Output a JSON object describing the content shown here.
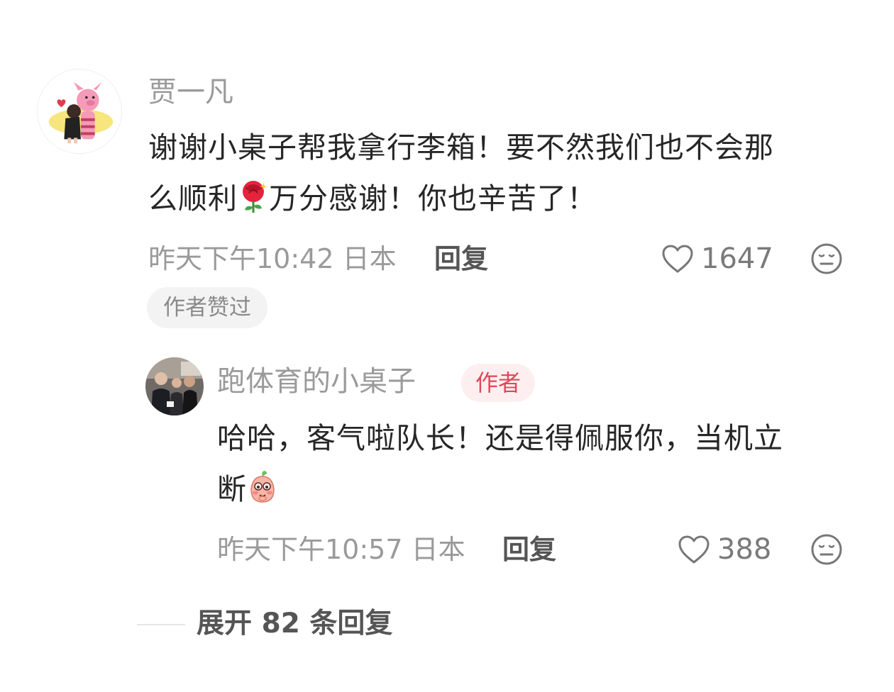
{
  "comment": {
    "username": "贾一凡",
    "text_line1": "谢谢小桌子帮我拿行李箱！要不然我们也不会那",
    "text_line2_a": "么顺利",
    "text_line2_b": "万分感谢！你也辛苦了！",
    "emoji": "rose-emoji",
    "time": "昨天下午10:42 日本",
    "reply_label": "回复",
    "like_count": "1647",
    "author_liked_badge": "作者赞过"
  },
  "reply": {
    "username": "跑体育的小桌子",
    "author_tag": "作者",
    "text_line1": "哈哈，客气啦队长！还是得佩服你，当机立",
    "text_line2": "断",
    "emoji": "peach-blush-emoji",
    "time": "昨天下午10:57 日本",
    "reply_label": "回复",
    "like_count": "388"
  },
  "expand_replies": "展开 82 条回复",
  "colors": {
    "text_primary": "#262626",
    "text_secondary": "#9a9a9a",
    "author_tag_bg": "#fdeff0",
    "author_tag_text": "#e0485b"
  }
}
